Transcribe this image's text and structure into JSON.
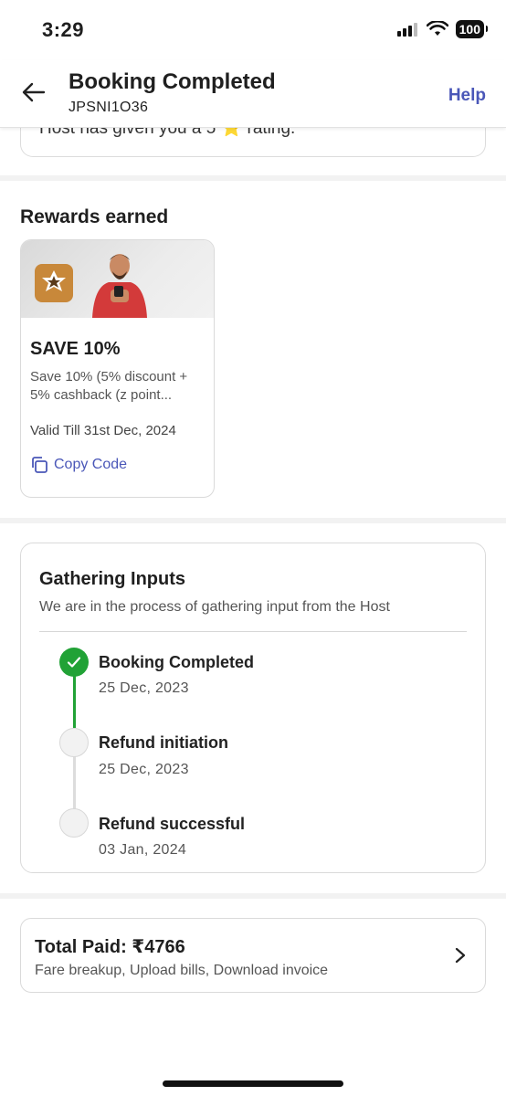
{
  "status_bar": {
    "time": "3:29",
    "battery": "100"
  },
  "header": {
    "title": "Booking Completed",
    "booking_id": "JPSNI1O36",
    "help": "Help"
  },
  "previous_card": {
    "text": "Host has given you a 5 ⭐ rating."
  },
  "rewards": {
    "section_title": "Rewards earned",
    "card": {
      "heading": "SAVE 10%",
      "description": "Save 10% (5% discount + 5% cashback (z point...",
      "valid_till": "Valid Till 31st Dec, 2024",
      "copy_label": "Copy Code"
    }
  },
  "gathering": {
    "title": "Gathering Inputs",
    "subtitle": "We are in the process of gathering input from the Host",
    "steps": [
      {
        "label": "Booking Completed",
        "date": "25 Dec, 2023",
        "status": "done"
      },
      {
        "label": "Refund initiation",
        "date": "25 Dec, 2023",
        "status": "pending"
      },
      {
        "label": "Refund successful",
        "date": "03 Jan, 2024",
        "status": "pending"
      }
    ]
  },
  "total": {
    "title": "Total Paid: ₹4766",
    "subtitle": "Fare breakup, Upload bills, Download invoice"
  },
  "colors": {
    "accent": "#4a57b8",
    "success": "#21a236",
    "badge": "#c8883a"
  }
}
